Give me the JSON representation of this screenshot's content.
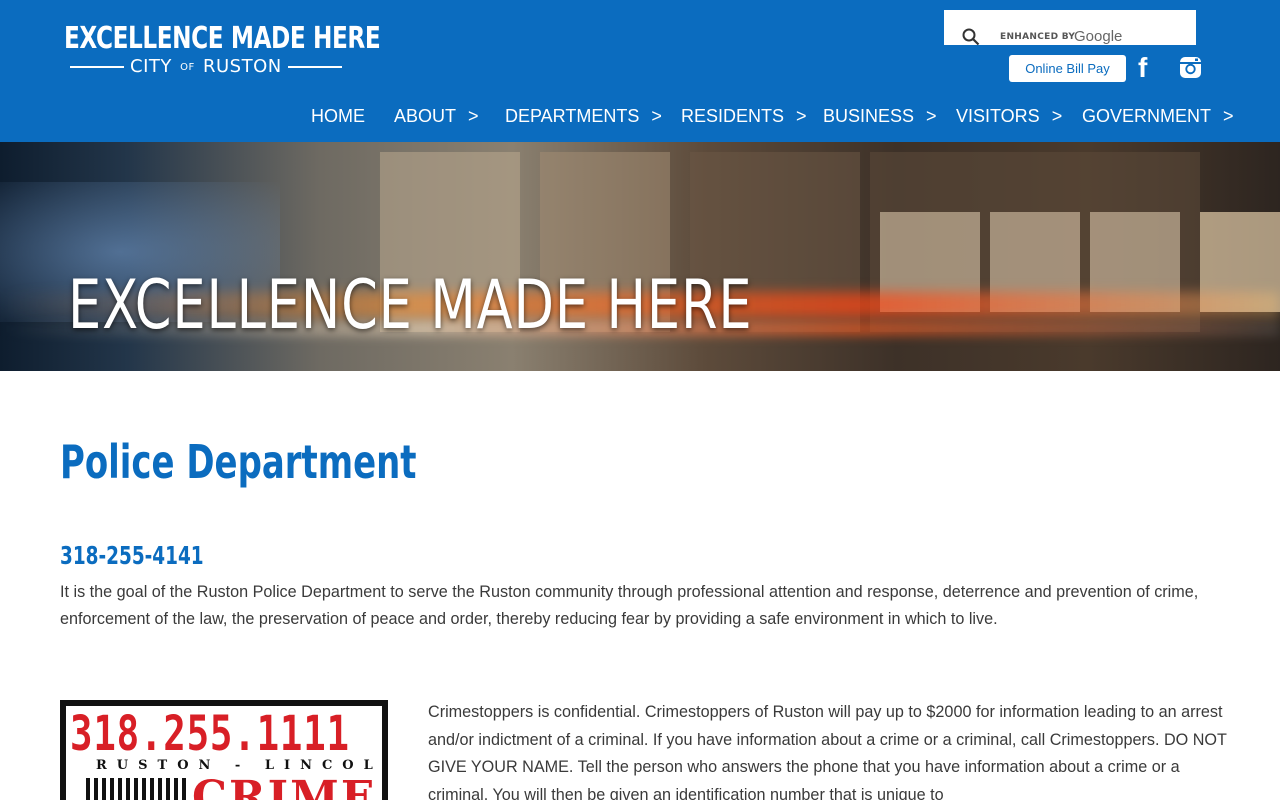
{
  "header": {
    "logo_main": "EXCELLENCE MADE HERE",
    "logo_sub_before": "CITY",
    "logo_sub_of": "OF",
    "logo_sub_after": "RUSTON",
    "search": {
      "enhanced_by": "ENHANCED BY",
      "google": "Google",
      "icon": "search-icon"
    },
    "bill_pay_label": "Online Bill Pay",
    "social": {
      "facebook_icon": "facebook-icon",
      "instagram_icon": "instagram-icon"
    },
    "brand_color": "#0b6cbf"
  },
  "nav": {
    "items": [
      {
        "label": "HOME",
        "arrow": ""
      },
      {
        "label": "ABOUT",
        "arrow": ">"
      },
      {
        "label": "DEPARTMENTS",
        "arrow": ">"
      },
      {
        "label": "RESIDENTS",
        "arrow": ">"
      },
      {
        "label": "BUSINESS",
        "arrow": ">"
      },
      {
        "label": "VISITORS",
        "arrow": ">"
      },
      {
        "label": "GOVERNMENT",
        "arrow": ">"
      }
    ]
  },
  "hero": {
    "title": "EXCELLENCE MADE HERE"
  },
  "main": {
    "page_title": "Police Department",
    "phone": "318-255-4141",
    "mission": "It is the goal of the Ruston Police Department to serve the Ruston community through professional attention and response, deterrence and prevention of crime, enforcement of the law, the preservation of peace and order, thereby reducing fear by providing a safe environment in which to live.",
    "crime_image": {
      "phone": "318.255.1111",
      "sub": "RUSTON - LINCOLN",
      "word": "CRIME"
    },
    "crimestoppers_text": "Crimestoppers is confidential. Crimestoppers of Ruston will pay up to $2000 for information leading to an arrest and/or indictment of a criminal. If you have information about a crime or a criminal, call Crimestoppers. DO NOT GIVE YOUR NAME. Tell the person who answers the phone that you have information about a crime or a criminal. You will then be given an identification number that is unique to"
  }
}
